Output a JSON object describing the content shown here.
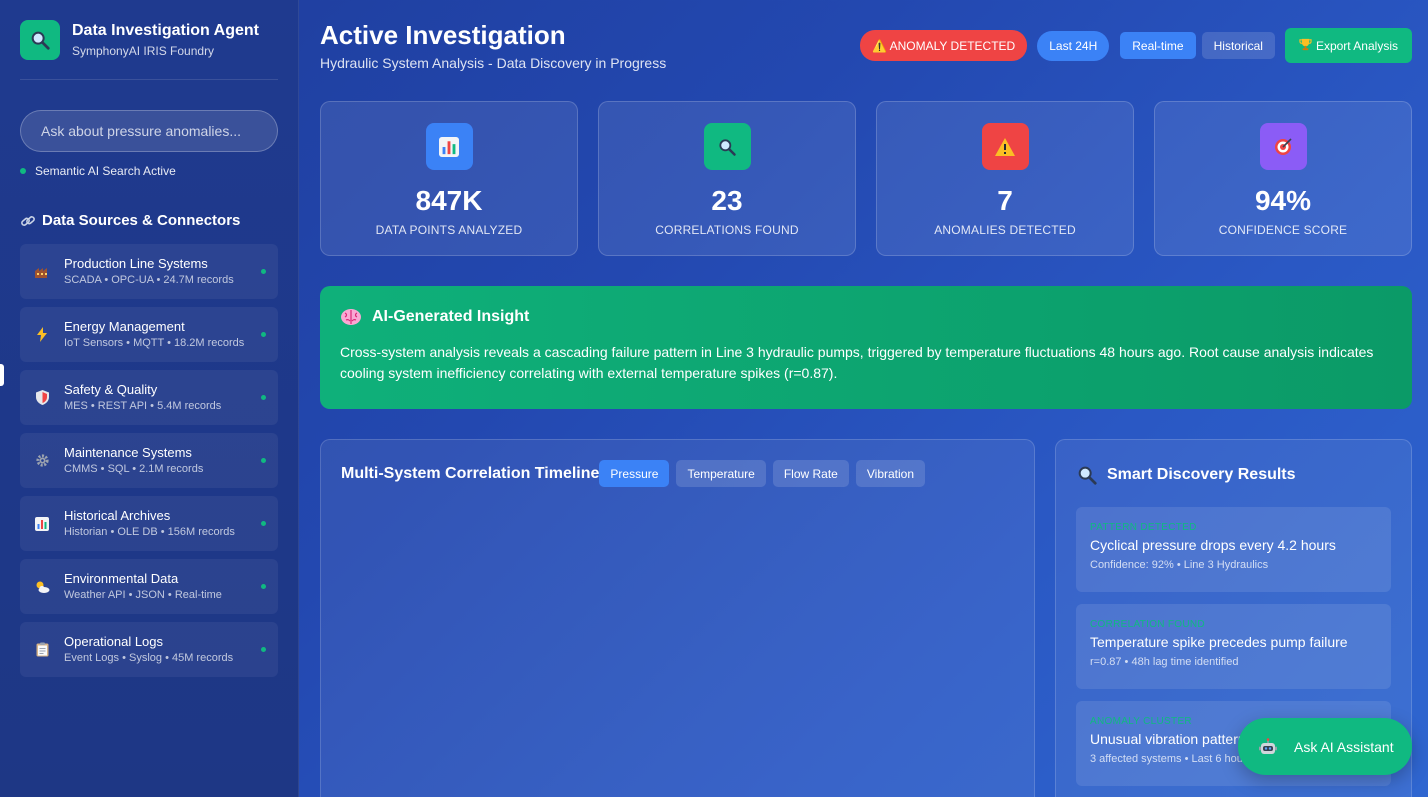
{
  "brand": {
    "title": "Data Investigation Agent",
    "subtitle": "SymphonyAI IRIS Foundry",
    "icon": "magnifier-icon"
  },
  "search": {
    "placeholder": "Ask about pressure anomalies...",
    "status": "Semantic AI Search Active"
  },
  "sources": {
    "title": "Data Sources & Connectors",
    "items": [
      {
        "name": "Production Line Systems",
        "meta": "SCADA • OPC-UA • 24.7M records",
        "icon": "factory-icon"
      },
      {
        "name": "Energy Management",
        "meta": "IoT Sensors • MQTT • 18.2M records",
        "icon": "lightning-icon"
      },
      {
        "name": "Safety & Quality",
        "meta": "MES • REST API • 5.4M records",
        "icon": "shield-icon"
      },
      {
        "name": "Maintenance Systems",
        "meta": "CMMS • SQL • 2.1M records",
        "icon": "gear-icon"
      },
      {
        "name": "Historical Archives",
        "meta": "Historian • OLE DB • 156M records",
        "icon": "bar-chart-icon"
      },
      {
        "name": "Environmental Data",
        "meta": "Weather API • JSON • Real-time",
        "icon": "weather-icon"
      },
      {
        "name": "Operational Logs",
        "meta": "Event Logs • Syslog • 45M records",
        "icon": "clipboard-icon"
      }
    ]
  },
  "header": {
    "title": "Active Investigation",
    "subtitle": "Hydraulic System Analysis - Data Discovery in Progress",
    "anomaly_badge": "⚠️ ANOMALY DETECTED",
    "range": "Last 24H",
    "modes": [
      "Real-time",
      "Historical"
    ],
    "active_mode": "Real-time",
    "export_label": "Export Analysis"
  },
  "stats": [
    {
      "value": "847K",
      "label": "DATA POINTS ANALYZED",
      "icon": "bar-chart-icon",
      "color": "#3b82f6"
    },
    {
      "value": "23",
      "label": "CORRELATIONS FOUND",
      "icon": "magnifier-icon",
      "color": "#10b981"
    },
    {
      "value": "7",
      "label": "ANOMALIES DETECTED",
      "icon": "warning-icon",
      "color": "#ef4444"
    },
    {
      "value": "94%",
      "label": "CONFIDENCE SCORE",
      "icon": "target-icon",
      "color": "#8b5cf6"
    }
  ],
  "insight": {
    "title": "AI-Generated Insight",
    "text": "Cross-system analysis reveals a cascading failure pattern in Line 3 hydraulic pumps, triggered by temperature fluctuations 48 hours ago. Root cause analysis indicates cooling system inefficiency correlating with external temperature spikes (r=0.87)."
  },
  "timeline": {
    "title": "Multi-System Correlation Timeline",
    "tabs": [
      "Pressure",
      "Temperature",
      "Flow Rate",
      "Vibration"
    ],
    "active_tab": "Pressure"
  },
  "discovery": {
    "title": "Smart Discovery Results",
    "items": [
      {
        "tag": "PATTERN DETECTED",
        "title": "Cyclical pressure drops every 4.2 hours",
        "meta": "Confidence: 92% • Line 3 Hydraulics"
      },
      {
        "tag": "CORRELATION FOUND",
        "title": "Temperature spike precedes pump failure",
        "meta": "r=0.87 • 48h lag time identified"
      },
      {
        "tag": "ANOMALY CLUSTER",
        "title": "Unusual vibration patterns",
        "meta": "3 affected systems • Last 6 hours"
      }
    ]
  },
  "assistant": {
    "label": "Ask AI Assistant",
    "icon": "robot-icon"
  },
  "colors": {
    "accent_green": "#10b981",
    "accent_blue": "#3b82f6",
    "alert_red": "#ef4444",
    "purple": "#8b5cf6"
  }
}
